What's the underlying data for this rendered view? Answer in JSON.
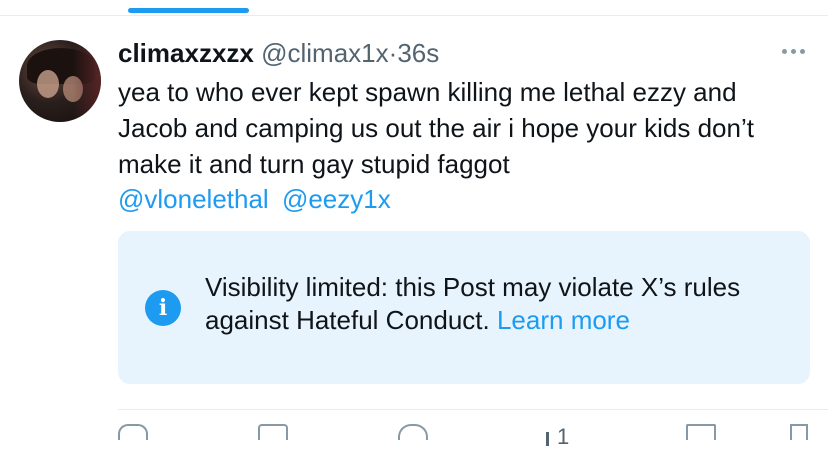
{
  "post": {
    "display_name": "climaxzxzx",
    "handle": "@climax1x",
    "separator": "·",
    "timestamp": "36s",
    "text": "yea to who ever kept spawn killing me lethal ezzy and Jacob and camping us out the air i hope your kids don’t make it and turn gay stupid faggot",
    "mentions": [
      "@vlonelethal",
      "@eezy1x"
    ]
  },
  "notice": {
    "text": "Visibility limited: this Post may violate X’s rules against Hateful Conduct.",
    "link": "Learn more",
    "icon": "info-icon"
  },
  "actions": {
    "views_count": "1"
  },
  "colors": {
    "accent": "#1d9bf0",
    "notice_bg": "#e8f4fd",
    "secondary_text": "#536471"
  }
}
